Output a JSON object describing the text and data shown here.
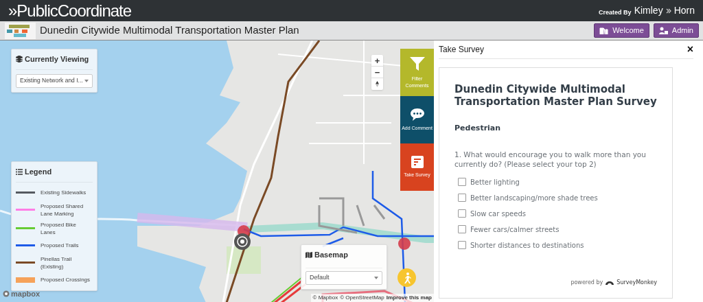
{
  "header": {
    "logo": "»PublicCoordinate",
    "credit_prefix": "Created By",
    "credit_brand": [
      "Kimley",
      "Horn"
    ]
  },
  "subheader": {
    "title": "Dunedin Citywide Multimodal Transportation Master Plan",
    "buttons": [
      {
        "label": "Welcome",
        "kind": "welcome"
      },
      {
        "label": "Admin",
        "kind": "admin"
      }
    ]
  },
  "map": {
    "currently_viewing": {
      "title": "Currently Viewing",
      "value": "Existing Network and I..."
    },
    "legend": {
      "title": "Legend",
      "items": [
        {
          "label": "Existing Sidewalks",
          "color": "#555a60",
          "kind": "line"
        },
        {
          "label": "Proposed Shared Lane Marking",
          "color": "#ff7ee6",
          "kind": "line"
        },
        {
          "label": "Proposed Bike Lanes",
          "color": "#66cc33",
          "kind": "line"
        },
        {
          "label": "Proposed Trails",
          "color": "#1d5be8",
          "kind": "line"
        },
        {
          "label": "Pinellas Trail (Existing)",
          "color": "#7a4a25",
          "kind": "line"
        },
        {
          "label": "Proposed Crossings",
          "color": "#f6a25a",
          "kind": "band"
        }
      ]
    },
    "basemap": {
      "title": "Basemap",
      "value": "Default"
    },
    "side_actions": [
      {
        "label": "Filter Comments",
        "kind": "filter",
        "color": "#b4b82b"
      },
      {
        "label": "Add Comment",
        "kind": "comment",
        "color": "#0e4f69"
      },
      {
        "label": "Take Survey",
        "kind": "survey",
        "color": "#d8431f"
      }
    ],
    "zoom_controls": [
      "+",
      "−"
    ],
    "mapbox_logo": "mapbox",
    "attribution": [
      "© Mapbox",
      "© OpenStreetMap",
      "Improve this map"
    ]
  },
  "survey_panel": {
    "title": "Take Survey",
    "close": "×",
    "survey_title": "Dunedin Citywide Multimodal Transportation Master Plan Survey",
    "section": "Pedestrian",
    "question": "1. What would encourage you to walk more than you currently do? (Please select your top 2)",
    "options": [
      {
        "label": "Better lighting",
        "checked": false
      },
      {
        "label": "Better landscaping/more shade trees",
        "checked": false
      },
      {
        "label": "Slow car speeds",
        "checked": false
      },
      {
        "label": "Fewer cars/calmer streets",
        "checked": false
      },
      {
        "label": "Shorter distances to destinations",
        "checked": false
      }
    ],
    "powered_by": "powered by",
    "provider": "SurveyMonkey"
  }
}
